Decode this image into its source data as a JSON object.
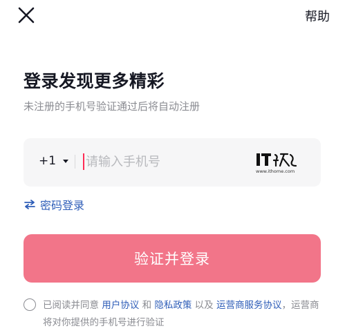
{
  "header": {
    "help_label": "帮助"
  },
  "title": "登录发现更多精彩",
  "subtitle": "未注册的手机号验证通过后将自动注册",
  "phone": {
    "country_code": "+1",
    "placeholder": "请输入手机号",
    "value": ""
  },
  "watermark": {
    "logo": "IT之家",
    "url": "www.ithome.com"
  },
  "password_login_label": "密码登录",
  "submit_label": "验证并登录",
  "agreement": {
    "prefix": "已阅读并同意 ",
    "user_agreement": "用户协议",
    "and": " 和 ",
    "privacy_policy": "隐私政策",
    "and_also": " 以及 ",
    "operator_agreement": "运营商服务协议",
    "suffix": "，运营商将对你提供的手机号进行验证"
  },
  "colors": {
    "accent": "#fe2c55",
    "button_disabled": "#f27589",
    "link": "#2f5eb8",
    "muted_text": "#8a8b91"
  }
}
